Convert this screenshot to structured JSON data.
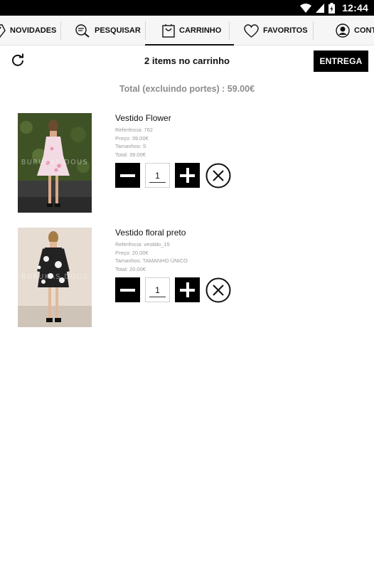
{
  "status_bar": {
    "time": "12:44"
  },
  "tabs": [
    {
      "label": "NOVIDADES",
      "icon": "tag-icon"
    },
    {
      "label": "PESQUISAR",
      "icon": "search-icon"
    },
    {
      "label": "CARRINHO",
      "icon": "shopping-bag-icon",
      "active": true
    },
    {
      "label": "FAVORITOS",
      "icon": "heart-icon"
    },
    {
      "label": "CONT",
      "icon": "user-icon"
    }
  ],
  "header": {
    "title": "2 items no carrinho",
    "delivery_label": "ENTREGA"
  },
  "total_line": "Total (excluindo portes) : 59.00€",
  "items": [
    {
      "name": "Vestido Flower",
      "reference": "Referência: 762",
      "price": "Preço: 39.00€",
      "sizes": "Tamanhos: S",
      "total": "Total: 39.00€",
      "quantity": "1",
      "watermark": "BURUKAS DOUS"
    },
    {
      "name": "Vestido floral preto",
      "reference": "Referência: vestido_15",
      "price": "Preço: 20.00€",
      "sizes": "Tamanhos: TAMANHO ÚNICO",
      "total": "Total: 20.00€",
      "quantity": "1",
      "watermark": "BURUKAS DOUS"
    }
  ],
  "colors": {
    "accent": "#000000",
    "muted_text": "#8c8c8c",
    "tab_bar_bg": "#f6f6f6"
  }
}
